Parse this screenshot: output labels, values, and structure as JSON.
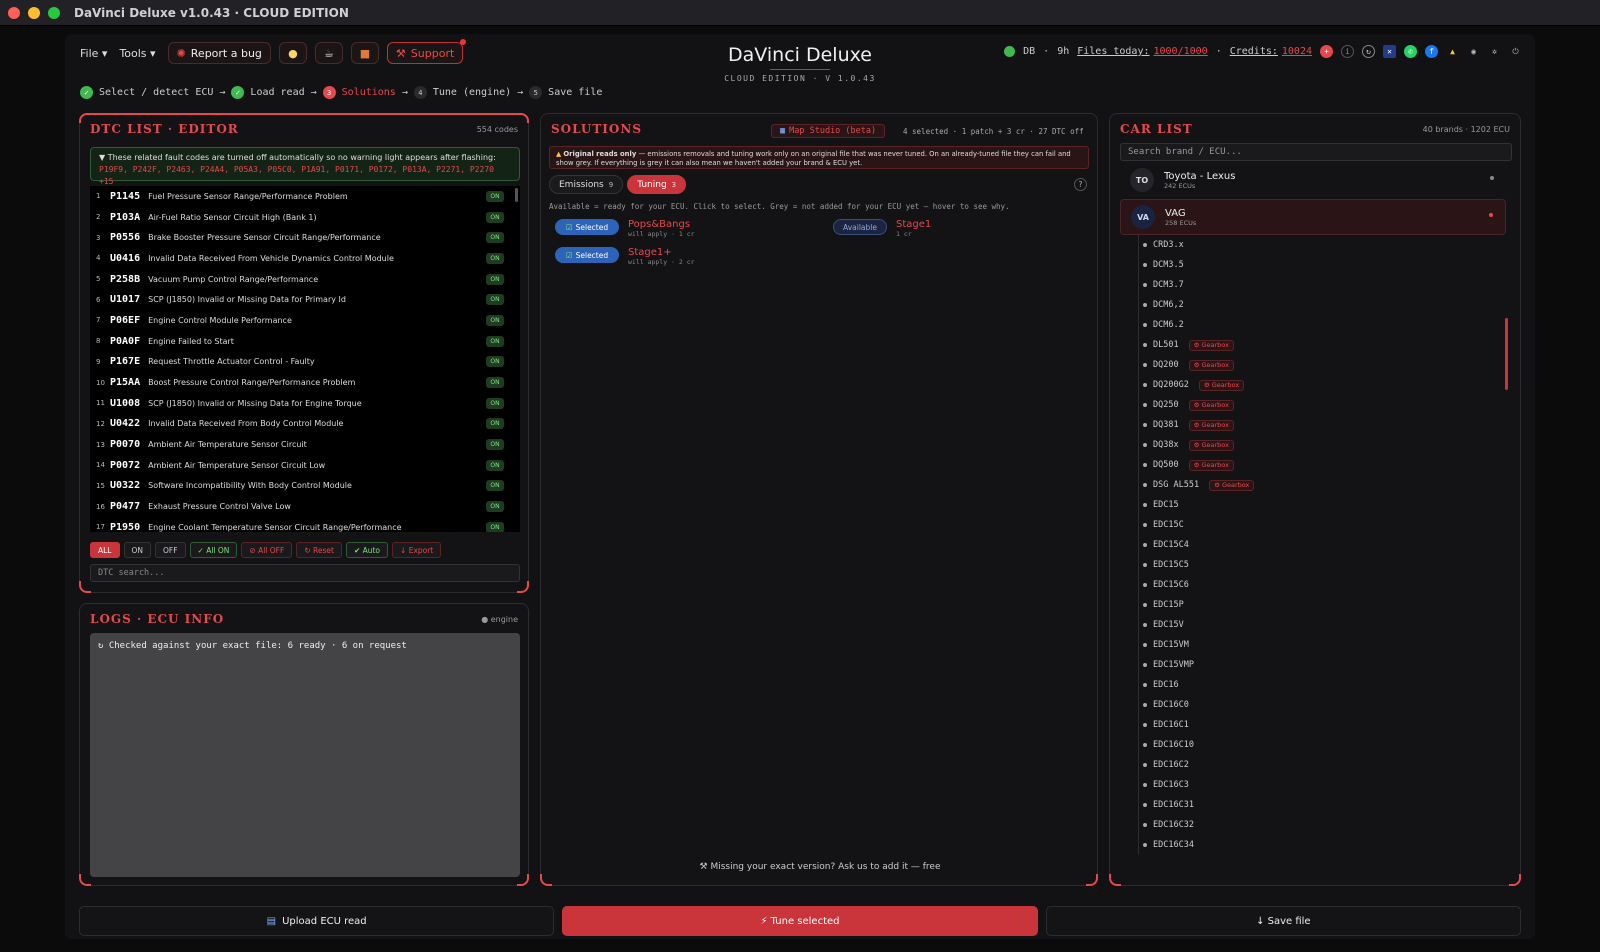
{
  "window": {
    "title": "DaVinci Deluxe v1.0.43 · CLOUD EDITION"
  },
  "menu": {
    "file": "File ▾",
    "tools": "Tools ▾",
    "report_bug": "Report a bug",
    "support": "Support"
  },
  "brand": {
    "title": "DaVinci Deluxe",
    "subtitle": "CLOUD EDITION · V 1.0.43"
  },
  "status": {
    "db": "DB",
    "uptime": "9h",
    "files_label": "Files today:",
    "files_value": "1000/1000",
    "credits_label": "Credits:",
    "credits_value": "10024",
    "sep": "·"
  },
  "steps": [
    {
      "label": "Select / detect ECU",
      "state": "done"
    },
    {
      "label": "Load read",
      "state": "done"
    },
    {
      "label": "Solutions",
      "num": "3",
      "state": "active"
    },
    {
      "label": "Tune (engine)",
      "num": "4",
      "state": "todo"
    },
    {
      "label": "Save file",
      "num": "5",
      "state": "todo"
    }
  ],
  "dtc": {
    "title": "DTC LIST · EDITOR",
    "count": "554 codes",
    "warning_text": "These related fault codes are turned off automatically so no warning light appears after flashing:",
    "warning_codes": "P19F9, P242F, P2463, P24A4, P05A3, P05C0, P1A91, P0171, P0172, P013A, P2271, P2270 +15",
    "rows": [
      {
        "n": "1",
        "code": "P1145",
        "desc": "Fuel Pressure Sensor Range/Performance Problem",
        "state": "ON"
      },
      {
        "n": "2",
        "code": "P103A",
        "desc": "Air-Fuel Ratio Sensor Circuit High (Bank 1)",
        "state": "ON"
      },
      {
        "n": "3",
        "code": "P0556",
        "desc": "Brake Booster Pressure Sensor Circuit Range/Performance",
        "state": "ON"
      },
      {
        "n": "4",
        "code": "U0416",
        "desc": "Invalid Data Received From Vehicle Dynamics Control Module",
        "state": "ON"
      },
      {
        "n": "5",
        "code": "P258B",
        "desc": "Vacuum Pump Control Range/Performance",
        "state": "ON"
      },
      {
        "n": "6",
        "code": "U1017",
        "desc": "SCP (J1850) Invalid or Missing Data for Primary Id",
        "state": "ON"
      },
      {
        "n": "7",
        "code": "P06EF",
        "desc": "Engine Control Module Performance",
        "state": "ON"
      },
      {
        "n": "8",
        "code": "P0A0F",
        "desc": "Engine Failed to Start",
        "state": "ON"
      },
      {
        "n": "9",
        "code": "P167E",
        "desc": "Request Throttle Actuator Control - Faulty",
        "state": "ON"
      },
      {
        "n": "10",
        "code": "P15AA",
        "desc": "Boost Pressure Control Range/Performance Problem",
        "state": "ON"
      },
      {
        "n": "11",
        "code": "U1008",
        "desc": "SCP (J1850) Invalid or Missing Data for Engine Torque",
        "state": "ON"
      },
      {
        "n": "12",
        "code": "U0422",
        "desc": "Invalid Data Received From Body Control Module",
        "state": "ON"
      },
      {
        "n": "13",
        "code": "P0070",
        "desc": "Ambient Air Temperature Sensor Circuit",
        "state": "ON"
      },
      {
        "n": "14",
        "code": "P0072",
        "desc": "Ambient Air Temperature Sensor Circuit Low",
        "state": "ON"
      },
      {
        "n": "15",
        "code": "U0322",
        "desc": "Software Incompatibility With Body Control Module",
        "state": "ON"
      },
      {
        "n": "16",
        "code": "P0477",
        "desc": "Exhaust Pressure Control Valve Low",
        "state": "ON"
      },
      {
        "n": "17",
        "code": "P1950",
        "desc": "Engine Coolant Temperature Sensor Circuit Range/Performance",
        "state": "ON"
      }
    ],
    "filters": [
      "ALL",
      "ON",
      "OFF",
      "✓ All ON",
      "⊘ All OFF",
      "↻ Reset",
      "✔ Auto",
      "↓ Export"
    ],
    "search_placeholder": "DTC search..."
  },
  "logs": {
    "title": "LOGS · ECU INFO",
    "tag": "● engine",
    "line": "↻ Checked against your exact file: 6 ready · 6 on request"
  },
  "solutions": {
    "title": "SOLUTIONS",
    "map_studio": "Map Studio (beta)",
    "meta": "4 selected · 1 patch + 3 cr · 27 DTC off",
    "warning_bold": "Original reads only",
    "warning_text": "— emissions removals and tuning work only on an original file that was never tuned. On an already-tuned file they can fail and show grey. If everything is grey it can also mean we haven't added your brand & ECU yet.",
    "tabs": [
      {
        "label": "Emissions",
        "count": "9"
      },
      {
        "label": "Tuning",
        "count": "3"
      }
    ],
    "hint": "Available = ready for your ECU. Click to select. Grey = not added for your ECU yet — hover to see why.",
    "items": [
      {
        "status": "Selected",
        "name": "Pops&Bangs",
        "sub": "will apply · 1 cr"
      },
      {
        "status": "Available",
        "name": "Stage1",
        "sub": "1 cr"
      },
      {
        "status": "Selected",
        "name": "Stage1+",
        "sub": "will apply · 2 cr"
      }
    ],
    "missing": "Missing your exact version? Ask us to add it — free"
  },
  "car": {
    "title": "CAR LIST",
    "meta": "40 brands · 1202 ECU",
    "search_placeholder": "Search brand / ECU...",
    "brands": [
      {
        "logo": "TO",
        "name": "Toyota - Lexus",
        "sub": "242 ECUs"
      },
      {
        "logo": "VA",
        "name": "VAG",
        "sub": "258 ECUs"
      }
    ],
    "gearbox_label": "⚙ Gearbox",
    "ecus": [
      {
        "name": "CRD3.x",
        "gearbox": false
      },
      {
        "name": "DCM3.5",
        "gearbox": false
      },
      {
        "name": "DCM3.7",
        "gearbox": false
      },
      {
        "name": "DCM6,2",
        "gearbox": false
      },
      {
        "name": "DCM6.2",
        "gearbox": false
      },
      {
        "name": "DL501",
        "gearbox": true
      },
      {
        "name": "DQ200",
        "gearbox": true
      },
      {
        "name": "DQ200G2",
        "gearbox": true
      },
      {
        "name": "DQ250",
        "gearbox": true
      },
      {
        "name": "DQ381",
        "gearbox": true
      },
      {
        "name": "DQ38x",
        "gearbox": true
      },
      {
        "name": "DQ500",
        "gearbox": true
      },
      {
        "name": "DSG AL551",
        "gearbox": true
      },
      {
        "name": "EDC15",
        "gearbox": false
      },
      {
        "name": "EDC15C",
        "gearbox": false
      },
      {
        "name": "EDC15C4",
        "gearbox": false
      },
      {
        "name": "EDC15C5",
        "gearbox": false
      },
      {
        "name": "EDC15C6",
        "gearbox": false
      },
      {
        "name": "EDC15P",
        "gearbox": false
      },
      {
        "name": "EDC15V",
        "gearbox": false
      },
      {
        "name": "EDC15VM",
        "gearbox": false
      },
      {
        "name": "EDC15VMP",
        "gearbox": false
      },
      {
        "name": "EDC16",
        "gearbox": false
      },
      {
        "name": "EDC16C0",
        "gearbox": false
      },
      {
        "name": "EDC16C1",
        "gearbox": false
      },
      {
        "name": "EDC16C10",
        "gearbox": false
      },
      {
        "name": "EDC16C2",
        "gearbox": false
      },
      {
        "name": "EDC16C3",
        "gearbox": false
      },
      {
        "name": "EDC16C31",
        "gearbox": false
      },
      {
        "name": "EDC16C32",
        "gearbox": false
      },
      {
        "name": "EDC16C34",
        "gearbox": false
      }
    ]
  },
  "bottom": {
    "upload": "Upload ECU read",
    "tune": "⚡ Tune selected",
    "save": "↓ Save file"
  },
  "colors": {
    "accent": "#e5484d",
    "ok": "#3fb950",
    "selected": "#2d63b8"
  }
}
